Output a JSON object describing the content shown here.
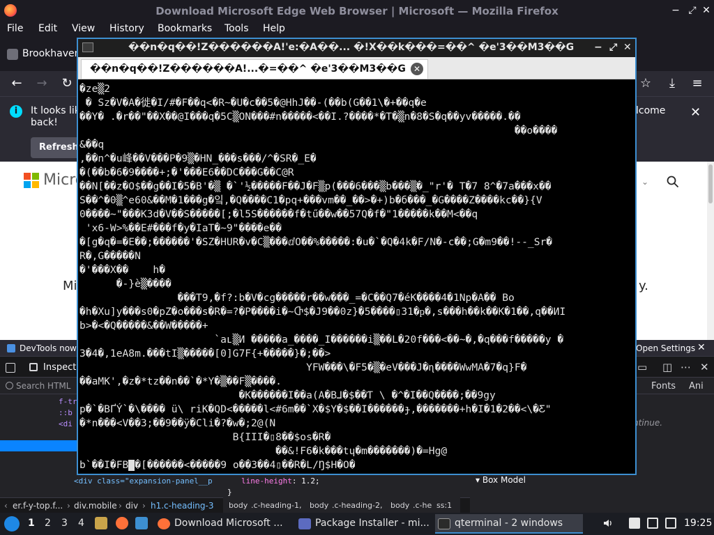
{
  "firefox": {
    "window_title": "Download Microsoft Edge Web Browser | Microsoft — Mozilla Firefox",
    "menu": [
      "File",
      "Edit",
      "View",
      "History",
      "Bookmarks",
      "Tools",
      "Help"
    ],
    "tab_label": "Brookhaven",
    "notice_left": "It looks like you haven't started Firefox in a while. Do you want to clean it up for a fresh, like-new experience? And by the way, welcome back!",
    "notice_left_visible": "It looks lik back!",
    "notice_right": "lcome",
    "notice_button": "Refresh",
    "page": {
      "brand": "Micro",
      "hero_left": "Mi",
      "hero_right": "y."
    }
  },
  "devtools": {
    "notice_left": "DevTools now f",
    "notice_right": "Open Settings",
    "inspector_tab": "Inspecto",
    "search_placeholder": "Search HTML",
    "right_tabs": [
      "Fonts",
      "Ani"
    ],
    "html_lines": [
      "f-tr",
      "::b",
      "<di",
      "<div class=\"expansion-panel__p"
    ],
    "rule": {
      "prop": "line-height",
      "value": "1.2;"
    },
    "rule_close": "}",
    "continue_text": "ntinue.",
    "box_model": "Box Model",
    "breadcrumbs": [
      "er.f-y-top.f...",
      "div.mobile",
      "div",
      "h1.c-heading-3"
    ],
    "status": [
      "body",
      ".c-heading-1,",
      "body",
      ".c-heading-2,",
      "body",
      ".c-he",
      "ss:1"
    ]
  },
  "terminal": {
    "window_title": "��n�q��!Z������A!'e:�A��... �!X��k���=��^ �e'3��M3��G",
    "tab_title": "��n�q��!Z������A!...�=��^ �e'3��M3��G",
    "lines": [
      "�ze▒2",
      " � Sz�V�A�徙�I/#�F��q<�R~�U�c��5�@HhJ��-(��b(G��1\\�+��q�e",
      "��Y� .�r��\"��X��@I���q�5C▒ON���#n�����<��I.?����*�T�▒n�8�S�q��yv�����.��",
      "                                                                       ��o����",
      "&��q",
      ",��n^�u峰��V���P�9▒�HN_���s���/^�SR�_E�",
      "�(��b�6�9����+;�'���E6��DC���G��C@R",
      "��N[��z�O$��g��I�5�B'�▒ �`'½�����F��J�F▒p(���6���▒b���▒�_\"r'� T�7 8^�7a���x��",
      "S��^�0▒^e60&��M�1���g�잌,�Q����C1�pq+���vm��_��>�+)b�б���_�G����Z����kc��}{V",
      "0����~\"���K3d�V��S�����[;�l5S������f�tű��w��57Q�f�\"1�����k��M<��q",
      " 'x6-W>%��E#���f�y�IaT�~9\"����e��",
      "�[g�q�=�E��;������'�SZ�HUR�v�C▒���ⅆO��%�����:�u�`�Q�4k�F/N�-c��;G�m9��!--_Sr�",
      "R�,G�����N",
      "�'���X��    h�",
      "      �-}è▒����",
      "                ���T9,�f?:b�V�cg�����r��w���_=�C��Q7�éK����4�1Np�A�� Bo",
      "�h�Xu]y���s0�pZ�o���s�R�=?�P����i�~Ⴇ$�J9��0z}�5����▯31�ҏ�,s���h��k��K�1��,q��ИI",
      "b>�<�Q�����&��W�����+",
      "                      `aʟ▒И �����a_����_I������i▒��L�20f���<��~�,�q���f�����y �",
      "3�4�,1eA8m.���tI▒�����[0]G7F{+�����}�;��>",
      "                                     YFW���\\�F5�▒�eV���J�ɳ����WwMA�7�q}F�",
      "��aMK',�z�*tz��n��`�*Y�▒��F▒����.",
      "                          �K������I��a(A�B⅃�$��Ƭ \\ �^�I��Q����;��9gy",
      "p�`�BҐÝ`�\\���� ü\\ riK�QD<�����l<#6m��`X�$Y�$��I������ɟ,�������+h�I�1�2��<\\�Ƹ\"",
      "�*n���<V��3;��9��ÿ�Cli�?�w�;2@(N",
      "                         B{III�▯8��$os�R�",
      "                                ��&!F6�k���tɥ�m�������)�=Hg@",
      "b`��I�FB"
    ],
    "last_line_tail": "�[������<�����9 o��3��4▯��R�L/Ŋ$H�O�"
  },
  "taskbar": {
    "workspaces": [
      "1",
      "2",
      "3",
      "4"
    ],
    "tasks": [
      {
        "label": "Download Microsoft ...",
        "icon": "firefox-icon"
      },
      {
        "label": "Package Installer - mi...",
        "icon": "package-installer-icon"
      },
      {
        "label": "qterminal - 2 windows",
        "icon": "terminal-icon"
      }
    ],
    "clock": "19:25"
  },
  "colors": {
    "terminal_border": "#3d8fd1",
    "firefox_bg": "#1c1b22",
    "devtools_bg": "#232327",
    "taskbar_bg": "#1b1d23"
  }
}
